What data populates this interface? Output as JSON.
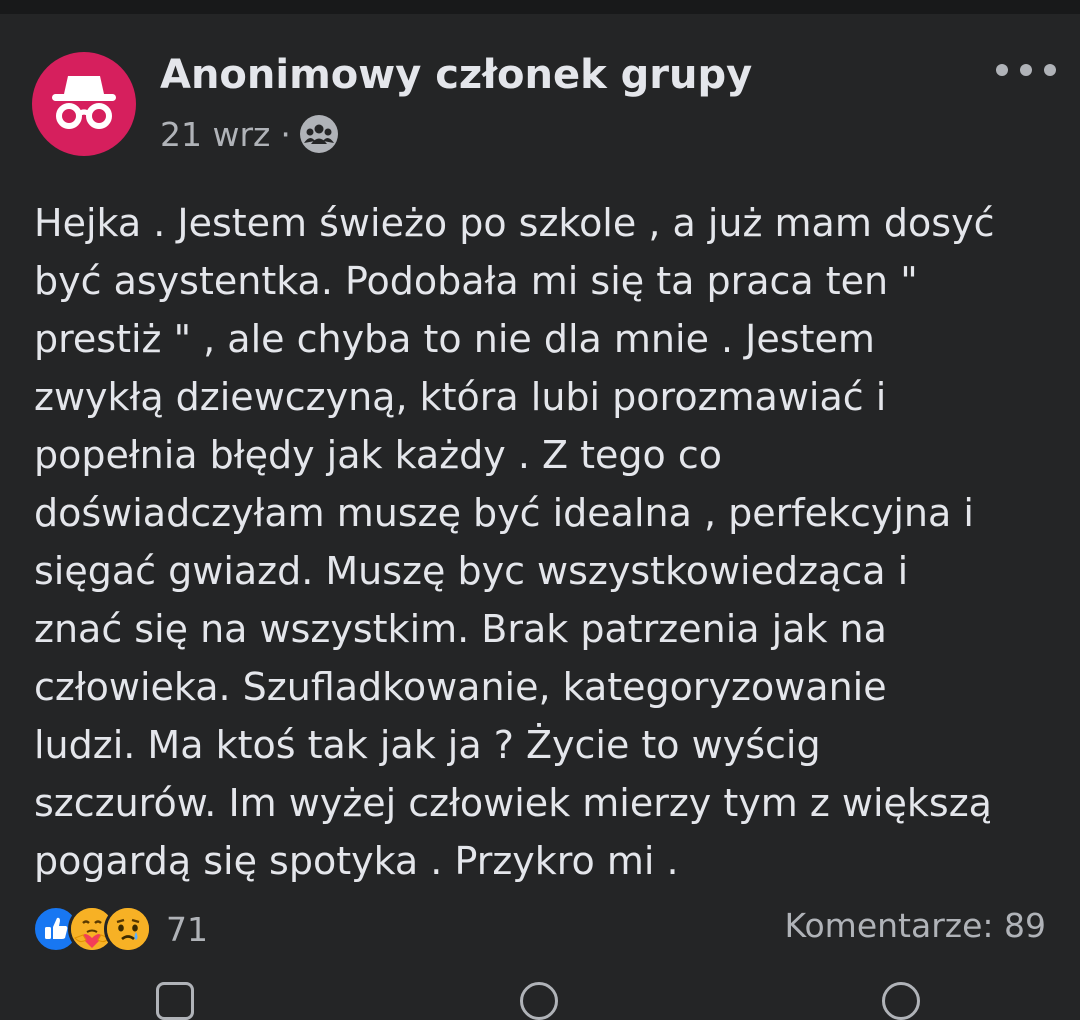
{
  "post": {
    "author": "Anonimowy członek grupy",
    "date": "21 wrz",
    "separator": "·",
    "audience_icon": "group-icon",
    "avatar_icon": "incognito-icon",
    "avatar_color": "#d61f5d",
    "more_icon": "more-horizontal-icon",
    "text": "Hejka . Jestem świeżo po szkole , a już mam dosyć\nbyć asystentka. Podobała mi się ta praca ten \"\nprestiż \" , ale chyba to nie dla mnie . Jestem\nzwykłą dziewczyną, która lubi porozmawiać i\npopełnia błędy jak każdy . Z tego co\ndoświadczyłam muszę być idealna , perfekcyjna i\nsięgać gwiazd. Muszę byc wszystkowiedząca i\nznać się na wszystkim. Brak patrzenia jak na\nczłowieka. Szufladkowanie, kategoryzowanie\nludzi. Ma ktoś tak jak ja ? Życie to wyścig\nszczurów. Im wyżej człowiek mierzy tym z większą\npogardą się spotyka . Przykro mi .",
    "reactions": {
      "icons": [
        "like-icon",
        "care-icon",
        "sad-icon"
      ],
      "count": "71"
    },
    "comments_label": "Komentarze: 89"
  },
  "colors": {
    "background": "#242526",
    "text_primary": "#e4e6eb",
    "text_secondary": "#b0b3b8",
    "like_blue": "#1877f2"
  }
}
